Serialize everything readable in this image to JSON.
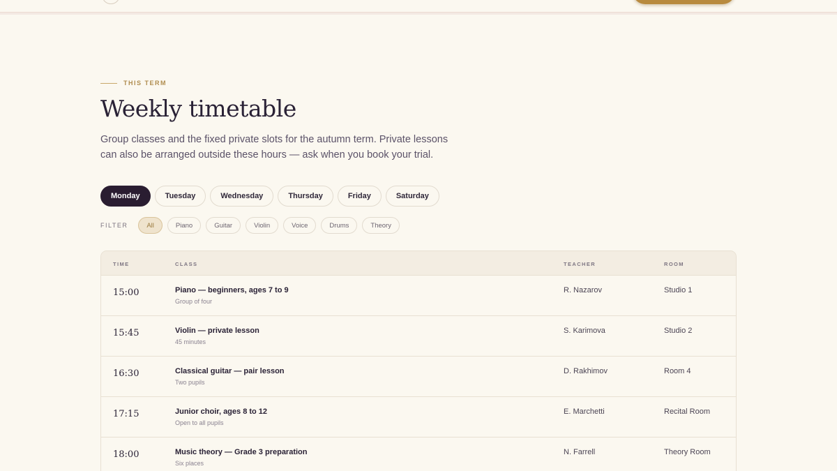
{
  "eyebrow": "THIS TERM",
  "title": "Weekly timetable",
  "lede": "Group classes and the fixed private slots for the autumn term. Private lessons can also be arranged outside these hours — ask when you book your trial.",
  "days": [
    {
      "label": "Monday",
      "active": true
    },
    {
      "label": "Tuesday",
      "active": false
    },
    {
      "label": "Wednesday",
      "active": false
    },
    {
      "label": "Thursday",
      "active": false
    },
    {
      "label": "Friday",
      "active": false
    },
    {
      "label": "Saturday",
      "active": false
    }
  ],
  "filter": {
    "label": "FILTER",
    "chips": [
      {
        "label": "All",
        "active": true
      },
      {
        "label": "Piano",
        "active": false
      },
      {
        "label": "Guitar",
        "active": false
      },
      {
        "label": "Violin",
        "active": false
      },
      {
        "label": "Voice",
        "active": false
      },
      {
        "label": "Drums",
        "active": false
      },
      {
        "label": "Theory",
        "active": false
      }
    ]
  },
  "table": {
    "headers": {
      "time": "TIME",
      "class": "CLASS",
      "teacher": "TEACHER",
      "room": "ROOM"
    },
    "rows": [
      {
        "time": "15:00",
        "class": "Piano — beginners, ages 7 to 9",
        "note": "Group of four",
        "teacher": "R. Nazarov",
        "room": "Studio 1"
      },
      {
        "time": "15:45",
        "class": "Violin — private lesson",
        "note": "45 minutes",
        "teacher": "S. Karimova",
        "room": "Studio 2"
      },
      {
        "time": "16:30",
        "class": "Classical guitar — pair lesson",
        "note": "Two pupils",
        "teacher": "D. Rakhimov",
        "room": "Room 4"
      },
      {
        "time": "17:15",
        "class": "Junior choir, ages 8 to 12",
        "note": "Open to all pupils",
        "teacher": "E. Marchetti",
        "room": "Recital Room"
      },
      {
        "time": "18:00",
        "class": "Music theory — Grade 3 preparation",
        "note": "Six places",
        "teacher": "N. Farrell",
        "room": "Theory Room"
      }
    ]
  },
  "colors": {
    "accent": "#b88a3e",
    "active_day": "#2a1d31",
    "background": "#fbf8f0"
  }
}
